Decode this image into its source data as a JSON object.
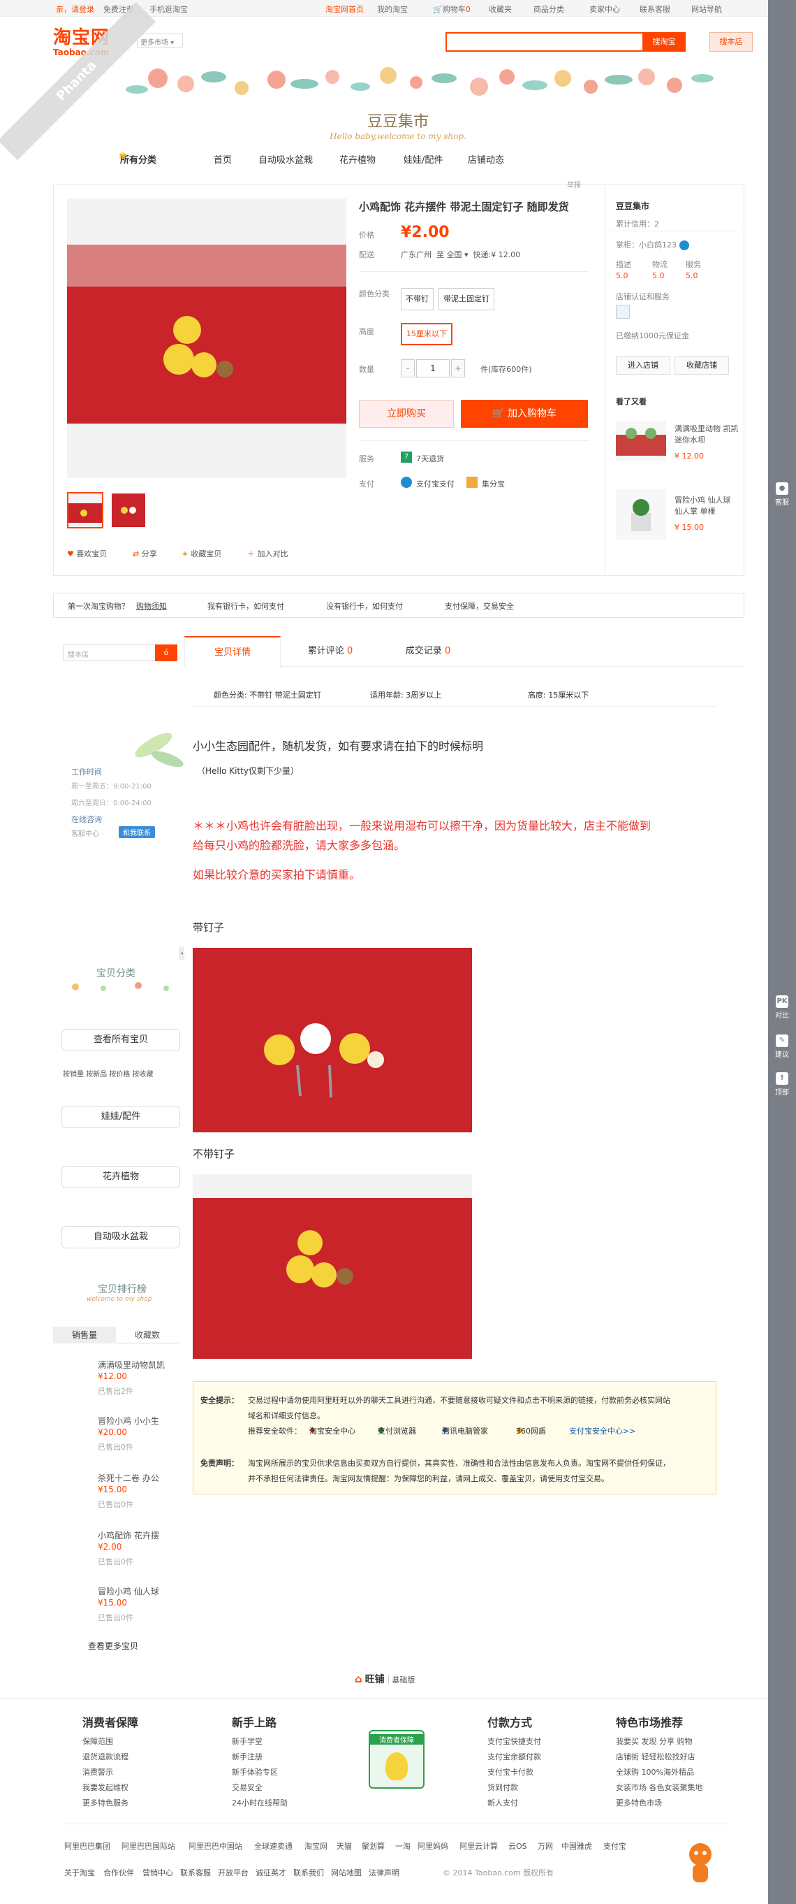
{
  "topnav": {
    "login_text": "亲，请登录",
    "register": "免费注册",
    "mobile": "手机逛淘宝",
    "home": "淘宝网首页",
    "my_taobao": "我的淘宝",
    "cart_label": "购物车",
    "cart_count": "0",
    "favorites": "收藏夹",
    "categories": "商品分类",
    "seller_center": "卖家中心",
    "contact": "联系客服",
    "site_nav": "网站导航"
  },
  "header": {
    "logo_cn": "淘宝网",
    "logo_en": "Taobao.com",
    "market_select": "更多市场",
    "search_all": "搜淘宝",
    "search_store": "搜本店"
  },
  "ribbon": "Phanta",
  "store": {
    "name": "豆豆集市",
    "tagline": "Hello baby,welcome to my shop.",
    "nav": [
      "所有分类",
      "首页",
      "自动吸水盆栽",
      "花卉植物",
      "娃娃/配件",
      "店铺动态"
    ]
  },
  "item": {
    "report": "举报",
    "title": "小鸡配饰 花卉摆件 带泥土固定钉子 随即发货",
    "price_label": "价格",
    "price": "¥2.00",
    "ship_label": "配送",
    "ship_from": "广东广州",
    "ship_to_label": "至",
    "ship_to": "全国",
    "ship_fee": "快递:¥ 12.00",
    "color_label": "颜色分类",
    "color_options": [
      "不带钉",
      "带泥土固定钉"
    ],
    "height_label": "高度",
    "height_option": "15厘米以下",
    "qty_label": "数量",
    "qty_value": "1",
    "qty_minus": "-",
    "qty_plus": "+",
    "stock": "件(库存600件)",
    "buy_now": "立即购买",
    "add_cart": "加入购物车",
    "service_label": "服务",
    "service": "7天退货",
    "pay_label": "支付",
    "pay_alipay": "支付宝支付",
    "pay_jifen": "集分宝",
    "actions": [
      "喜欢宝贝",
      "分享",
      "收藏宝贝",
      "加入对比"
    ]
  },
  "seller": {
    "shop_name": "豆豆集市",
    "credit": "累计信用：2",
    "owner_label": "掌柜：",
    "owner": "小白鸽123",
    "ratings": [
      {
        "label": "描述",
        "score": "5.0"
      },
      {
        "label": "物流",
        "score": "5.0"
      },
      {
        "label": "服务",
        "score": "5.0"
      }
    ],
    "cert": "店铺认证和服务",
    "deposit": "已缴纳1000元保证金",
    "enter_shop": "进入店铺",
    "fav_shop": "收藏店铺",
    "also_viewed": "看了又看",
    "rec": [
      {
        "name": "满满吸里动物 凯凯迷你水坝",
        "price": "¥ 12.00"
      },
      {
        "name": "冒险小鸡 仙人球 仙人掌 单棵",
        "price": "¥ 15.00"
      }
    ]
  },
  "trust_strip": [
    "第一次淘宝购物？",
    "购物须知",
    "我有银行卡，如何支付",
    "没有银行卡，如何支付",
    "支付保障，交易安全"
  ],
  "tabs": [
    {
      "label": "宝贝详情",
      "count": ""
    },
    {
      "label": "累计评论",
      "count": "0"
    },
    {
      "label": "成交记录",
      "count": "0"
    }
  ],
  "side_search": {
    "placeholder": "搜本店",
    "btn": "ó"
  },
  "attributes": [
    "颜色分类: 不带钉 带泥土固定钉",
    "适用年龄: 3周岁以上",
    "高度: 15厘米以下"
  ],
  "sidebar": {
    "work_time_label": "工作时间",
    "work_weekday": "周一至周五：9:00-21:00",
    "work_weekend": "周六至周日：0:00-24:00",
    "online_label": "在线咨询",
    "service_center": "客服中心",
    "contact_btn": "和我联系",
    "cat_title": "宝贝分类",
    "cat_all": "查看所有宝贝",
    "cat_sort": "按销量  按新品  按价格  按收藏",
    "cats": [
      "娃娃/配件",
      "花卉植物",
      "自动吸水盆栽"
    ],
    "rank_title": "宝贝排行榜",
    "rank_sub": "welcome to my shop",
    "rank_tabs": [
      "销售量",
      "收藏数"
    ],
    "rank_items": [
      {
        "name": "满满吸里动物凯凯",
        "price": "¥12.00",
        "sold": "已售出2件"
      },
      {
        "name": "冒险小鸡 小小生",
        "price": "¥20.00",
        "sold": "已售出0件"
      },
      {
        "name": "杀死十二卷 办公",
        "price": "¥15.00",
        "sold": "已售出0件"
      },
      {
        "name": "小鸡配饰 花卉摆",
        "price": "¥2.00",
        "sold": "已售出0件"
      },
      {
        "name": "冒险小鸡 仙人球",
        "price": "¥15.00",
        "sold": "已售出0件"
      }
    ],
    "view_more": "查看更多宝贝"
  },
  "description": {
    "line1": "小小生态园配件，随机发货，如有要求请在拍下的时候标明",
    "line2": "（Hello Kitty仅剩下少量）",
    "warn1": "＊＊＊小鸡也许会有脏脸出现，一般来说用湿布可以擦干净，因为货量比较大，店主不能做到",
    "warn2": "给每只小鸡的脸都洗脸，请大家多多包涵。",
    "warn3": "如果比较介意的买家拍下请慎重。",
    "with_nail": "带钉子",
    "without_nail": "不带钉子"
  },
  "notice": {
    "security_label": "安全提示：",
    "security_text1": "交易过程中请勿使用阿里旺旺以外的聊天工具进行沟通，不要随意接收可疑文件和点击不明来源的链接，付款前务必核实网站",
    "security_text2": "域名和详细支付信息。",
    "software_label": "推荐安全软件：",
    "software": [
      "淘宝安全中心",
      "支付浏览器",
      "腾讯电脑管家",
      "360网盾",
      "支付宝安全中心>>"
    ],
    "disclaimer_label": "免责声明：",
    "disclaimer1": "淘宝网所展示的宝贝供求信息由买卖双方自行提供，其真实性、准确性和合法性由信息发布人负责。淘宝网不提供任何保证，",
    "disclaimer2": "并不承担任何法律责任。淘宝网友情提醒：为保障您的利益，请网上成交、覆盖宝贝，请使用支付宝交易。"
  },
  "footer": {
    "brand": "旺铺",
    "brand_sub": "基础版",
    "cols": [
      {
        "title": "消费者保障",
        "items": [
          "保障范围",
          "退货退款流程",
          "消费警示",
          "我要发起维权",
          "更多特色服务"
        ]
      },
      {
        "title": "新手上路",
        "items": [
          "新手学堂",
          "新手注册",
          "新手体验专区",
          "交易安全",
          "24小时在线帮助"
        ]
      },
      {
        "title": "付款方式",
        "items": [
          "支付宝快捷支付",
          "支付宝余额付款",
          "支付宝卡付款",
          "货到付款",
          "新人支付"
        ]
      },
      {
        "title": "特色市场推荐",
        "items": [
          "我要买  发现  分享  购物",
          "店铺街  轻轻松松找好店",
          "全球购  100%海外精品",
          "女装市场  各色女装聚集地",
          "更多特色市场"
        ]
      }
    ],
    "badge": "消费者保障",
    "links1": [
      "阿里巴巴集团",
      "阿里巴巴国际站",
      "阿里巴巴中国站",
      "全球速卖通",
      "淘宝网",
      "天猫",
      "聚划算",
      "一淘",
      "阿里妈妈",
      "阿里云计算",
      "云OS",
      "万网",
      "中国雅虎",
      "支付宝"
    ],
    "links2": [
      "关于淘宝",
      "合作伙伴",
      "营销中心",
      "联系客服",
      "开放平台",
      "诚征英才",
      "联系我们",
      "网站地图",
      "法律声明"
    ],
    "copyright": "© 2014 Taobao.com 版权所有"
  },
  "rightbar": [
    {
      "label": "客服",
      "icon": "chat-icon"
    },
    {
      "label": "对比",
      "icon": "compare-icon"
    },
    {
      "label": "建议",
      "icon": "edit-icon"
    },
    {
      "label": "顶部",
      "icon": "top-icon"
    }
  ]
}
